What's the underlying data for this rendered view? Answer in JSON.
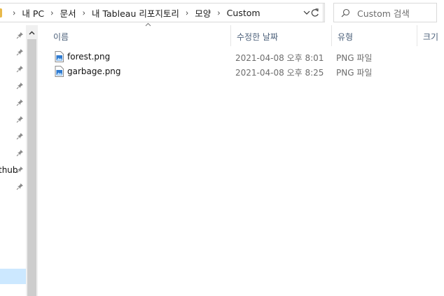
{
  "address_bar": {
    "breadcrumbs": [
      "내 PC",
      "문서",
      "내 Tableau 리포지토리",
      "모양",
      "Custom"
    ]
  },
  "search": {
    "placeholder": "Custom 검색"
  },
  "navigation": {
    "partial_label": "thub"
  },
  "columns": {
    "name": "이름",
    "modified": "수정한 날짜",
    "type": "유형",
    "size": "크기"
  },
  "files": [
    {
      "name": "forest.png",
      "modified": "2021-04-08 오후 8:01",
      "type": "PNG 파일"
    },
    {
      "name": "garbage.png",
      "modified": "2021-04-08 오후 8:25",
      "type": "PNG 파일"
    }
  ],
  "icons": {
    "breadcrumb_separator": "chevron-right-icon",
    "address_dropdown": "chevron-down-icon",
    "refresh": "refresh-icon",
    "search": "search-icon",
    "pin": "pin-icon",
    "file": "png-image-file-icon"
  },
  "colors": {
    "header_text": "#4c607a",
    "secondary_text": "#6d6d6d",
    "selection": "#cce8ff",
    "folder": "#e8b94a"
  }
}
